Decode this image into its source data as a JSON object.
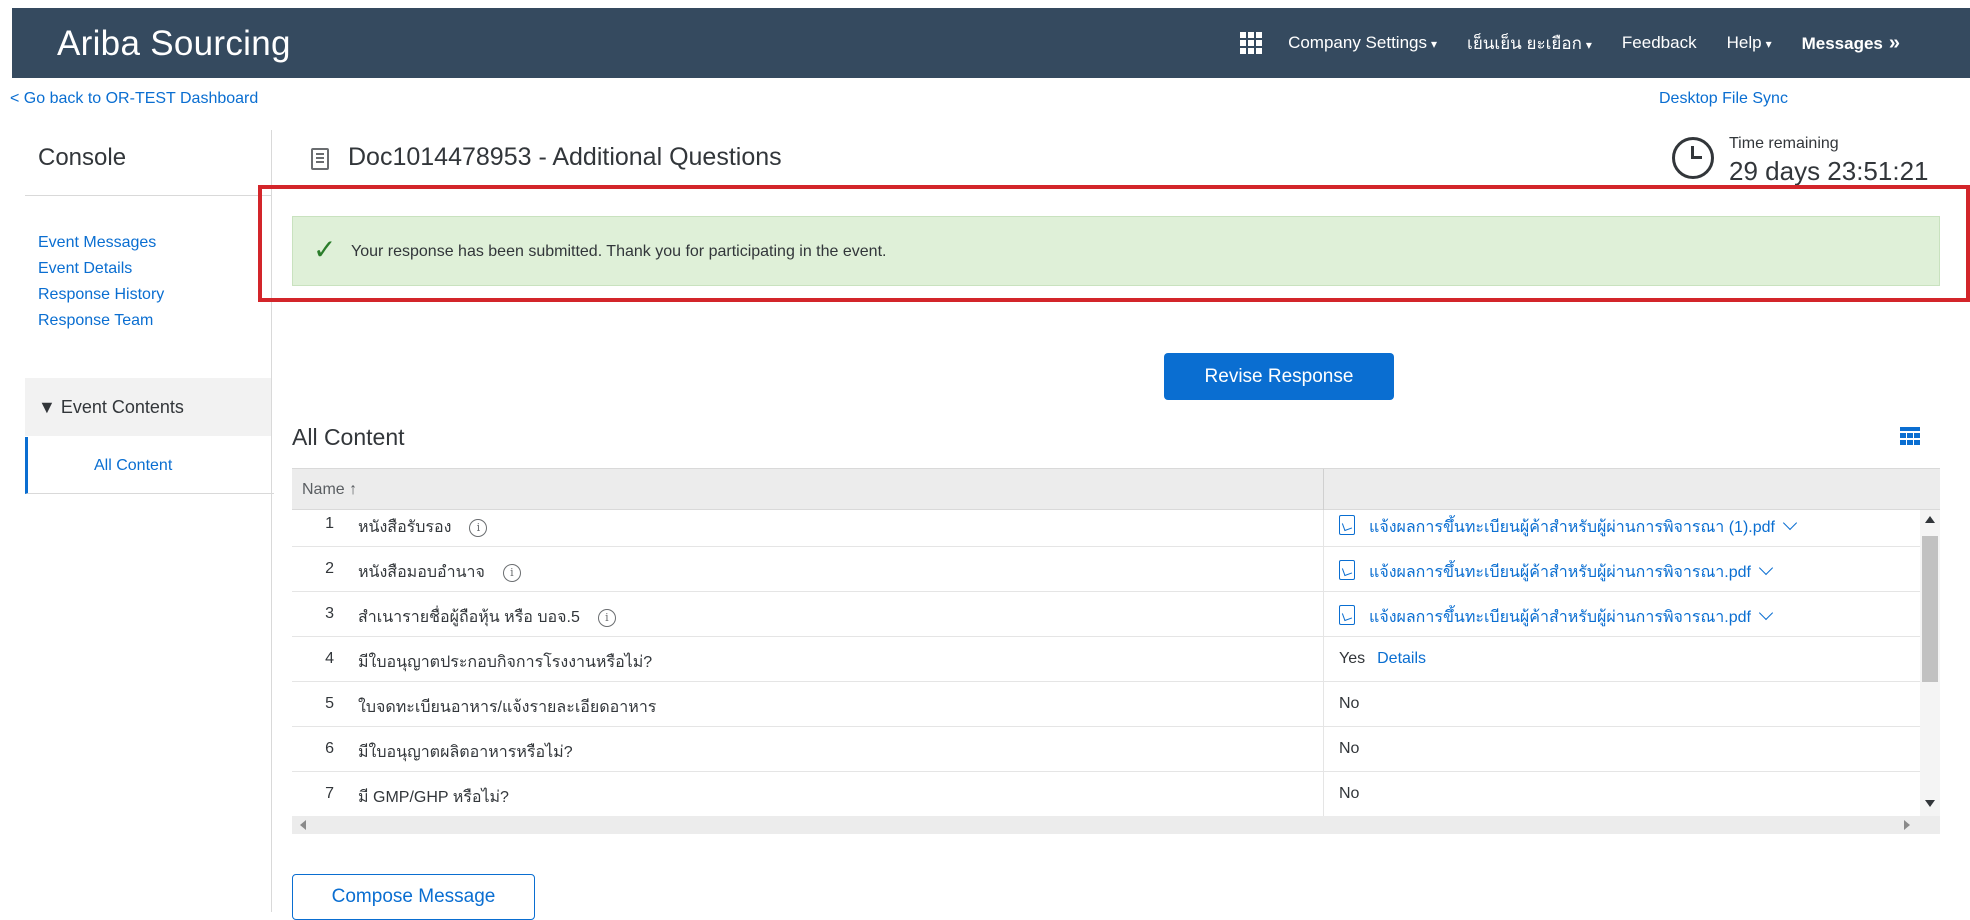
{
  "header": {
    "brand": "Ariba Sourcing",
    "nav": {
      "company_settings": "Company Settings",
      "user": "เย็นเย็น ยะเยือก",
      "feedback": "Feedback",
      "help": "Help",
      "messages": "Messages"
    },
    "caret": "▾",
    "messages_chevron": "»"
  },
  "links": {
    "back": "< Go back to OR-TEST Dashboard",
    "desktop_sync": "Desktop File Sync"
  },
  "sidebar": {
    "title": "Console",
    "links": [
      "Event Messages",
      "Event Details",
      "Response History",
      "Response Team"
    ],
    "section_label": "▼ Event Contents",
    "selected_item": "All Content"
  },
  "doc": {
    "title": "Doc1014478953 - Additional Questions"
  },
  "timer": {
    "label": "Time remaining",
    "value": "29 days 23:51:21"
  },
  "notice": {
    "check": "✓",
    "text": "Your response has been submitted. Thank you for participating in the event."
  },
  "buttons": {
    "revise": "Revise Response",
    "compose": "Compose Message"
  },
  "content": {
    "title": "All Content",
    "column_name": "Name",
    "sort_arrow": "↑",
    "rows": [
      {
        "num": "1",
        "name": "หนังสือรับรอง",
        "file": "แจ้งผลการขึ้นทะเบียนผู้ค้าสำหรับผู้ผ่านการพิจารณา (1).pdf"
      },
      {
        "num": "2",
        "name": "หนังสือมอบอำนาจ",
        "file": "แจ้งผลการขึ้นทะเบียนผู้ค้าสำหรับผู้ผ่านการพิจารณา.pdf"
      },
      {
        "num": "3",
        "name": "สำเนารายชื่อผู้ถือหุ้น หรือ บอจ.5",
        "file": "แจ้งผลการขึ้นทะเบียนผู้ค้าสำหรับผู้ผ่านการพิจารณา.pdf"
      },
      {
        "num": "4",
        "name": "มีใบอนุญาตประกอบกิจการโรงงานหรือไม่?",
        "value": "Yes",
        "details": "Details"
      },
      {
        "num": "5",
        "name": "ใบจดทะเบียนอาหาร/แจ้งรายละเอียดอาหาร",
        "value": "No"
      },
      {
        "num": "6",
        "name": "มีใบอนุญาตผลิตอาหารหรือไม่?",
        "value": "No"
      },
      {
        "num": "7",
        "name": "มี GMP/GHP หรือไม่?",
        "value": "No"
      }
    ]
  },
  "info_glyph": "i"
}
